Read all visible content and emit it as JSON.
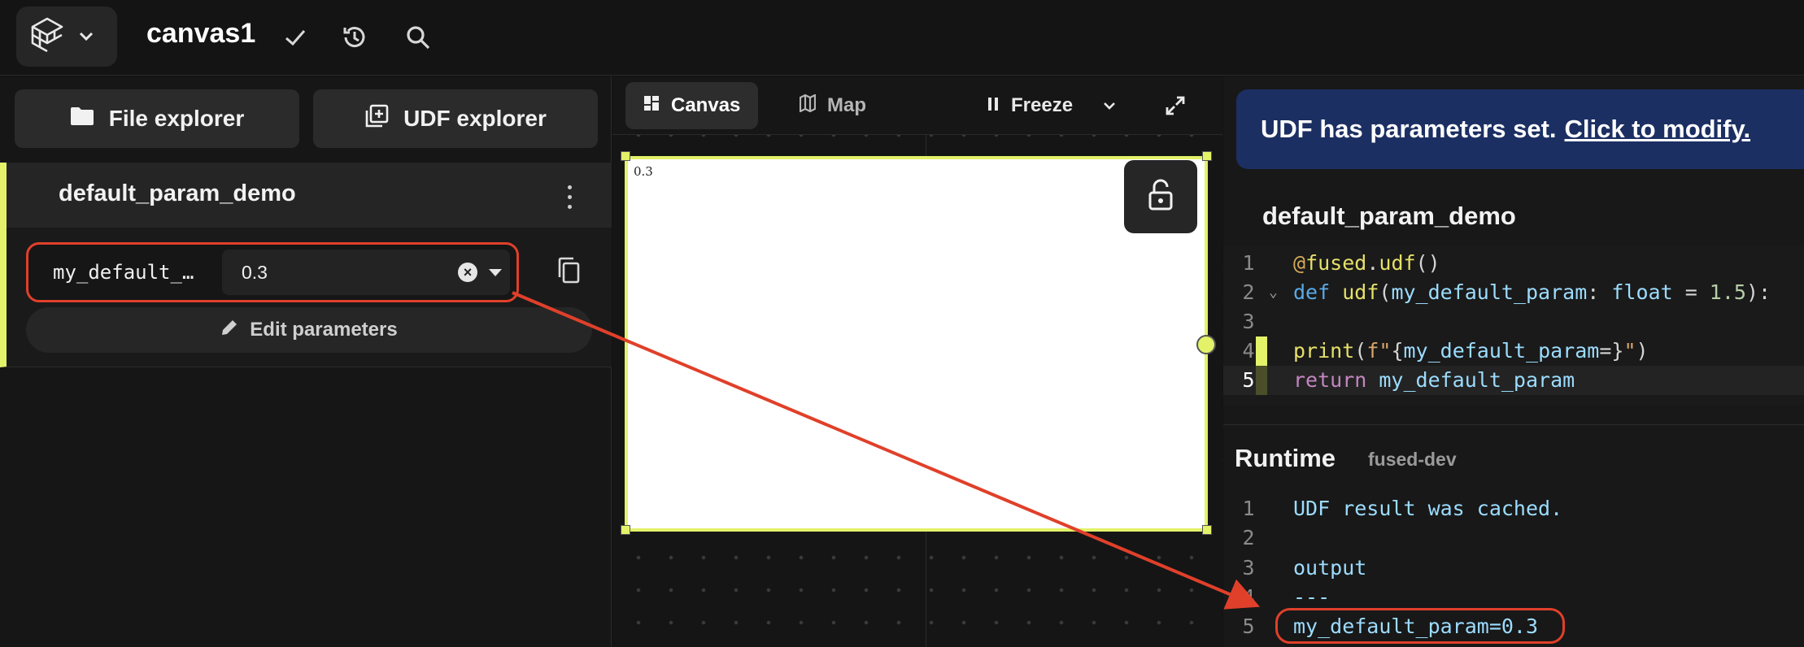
{
  "header": {
    "title": "canvas1",
    "icons": [
      "logo-icon",
      "chevron-down-icon",
      "check-icon",
      "history-icon",
      "search-icon"
    ]
  },
  "left_panel": {
    "file_explorer_label": "File explorer",
    "udf_explorer_label": "UDF explorer",
    "udf_name": "default_param_demo",
    "param": {
      "name": "my_default_…",
      "value": "0.3"
    },
    "edit_parameters_label": "Edit parameters"
  },
  "canvas_toolbar": {
    "canvas_tab": "Canvas",
    "map_tab": "Map",
    "freeze_label": "Freeze"
  },
  "canvas": {
    "output_text": "0.3"
  },
  "right_panel": {
    "banner_text": "UDF has parameters set.",
    "banner_link": "Click to modify.",
    "udf_title": "default_param_demo",
    "code_lines": [
      {
        "n": "1",
        "text": "@fused.udf()"
      },
      {
        "n": "2",
        "text": "def udf(my_default_param: float = 1.5):"
      },
      {
        "n": "3",
        "text": ""
      },
      {
        "n": "4",
        "text": "    print(f\"{my_default_param=}\")"
      },
      {
        "n": "5",
        "text": "    return my_default_param"
      }
    ],
    "runtime_label": "Runtime",
    "runtime_env": "fused-dev",
    "output_lines": [
      {
        "n": "1",
        "text": "UDF result was cached."
      },
      {
        "n": "2",
        "text": ""
      },
      {
        "n": "3",
        "text": "output"
      },
      {
        "n": "4",
        "text": "---"
      },
      {
        "n": "5",
        "text": "my_default_param=0.3"
      }
    ]
  },
  "colors": {
    "accent_yellow": "#e3f269",
    "annotation_red": "#e0402a",
    "banner_blue": "#1c2f63"
  }
}
